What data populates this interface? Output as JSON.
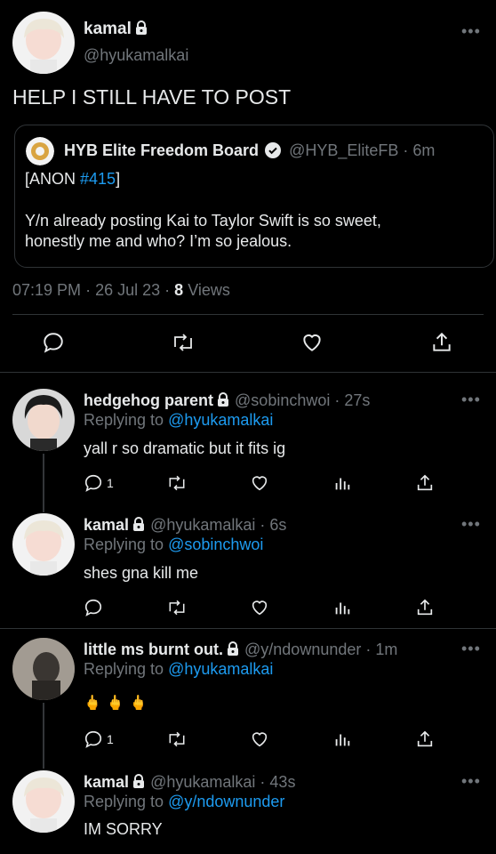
{
  "main_tweet": {
    "display_name": "kamal",
    "handle": "@hyukamalkai",
    "text": "HELP I STILL HAVE TO POST",
    "quote": {
      "display_name": "HYB Elite Freedom Board",
      "handle": "@HYB_EliteFB",
      "time": "6m",
      "anon_prefix": "[ANON ",
      "anon_tag": "#415",
      "anon_suffix": "]",
      "body_line1": "Y/n already posting Kai to Taylor Swift is so sweet,",
      "body_line2": "honestly me and who? I’m so jealous."
    },
    "meta": {
      "time": "07:19 PM",
      "date": "26 Jul 23",
      "views_count": "8",
      "views_label": "Views"
    }
  },
  "replies": [
    {
      "display_name": "hedgehog parent",
      "handle": "@sobinchwoi",
      "time": "27s",
      "replying_label": "Replying to",
      "replying_to": "@hyukamalkai",
      "text": "yall r so dramatic but it fits ig",
      "reply_count": "1"
    },
    {
      "display_name": "kamal",
      "handle": "@hyukamalkai",
      "time": "6s",
      "replying_label": "Replying to",
      "replying_to": "@sobinchwoi",
      "text": "shes gna kill me",
      "reply_count": ""
    },
    {
      "display_name": "little ms burnt out.",
      "handle": "@y/ndownunder",
      "time": "1m",
      "replying_label": "Replying to",
      "replying_to": "@hyukamalkai",
      "text": "🖕🖕🖕",
      "reply_count": "1"
    },
    {
      "display_name": "kamal",
      "handle": "@hyukamalkai",
      "time": "43s",
      "replying_label": "Replying to",
      "replying_to": "@y/ndownunder",
      "text": "IM SORRY",
      "reply_count": ""
    }
  ],
  "separator": "·",
  "colors": {
    "background": "#000000",
    "text": "#e7e9ea",
    "muted": "#71767b",
    "link": "#1d9bf0",
    "divider": "#2f3336"
  }
}
